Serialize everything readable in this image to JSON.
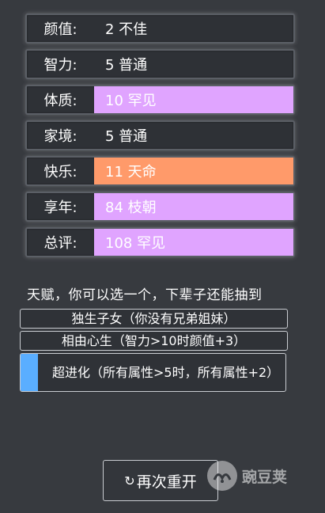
{
  "stats": [
    {
      "label": "颜值:",
      "value": "2 不佳",
      "color": "#2e3136"
    },
    {
      "label": "智力:",
      "value": "5 普通",
      "color": "#2e3136"
    },
    {
      "label": "体质:",
      "value": "10 罕见",
      "color": "#e0a4ff"
    },
    {
      "label": "家境:",
      "value": "5 普通",
      "color": "#2e3136"
    },
    {
      "label": "快乐:",
      "value": "11 天命",
      "color": "#ff9a6a"
    },
    {
      "label": "享年:",
      "value": "84 枝朝",
      "color": "#e0a4ff"
    },
    {
      "label": "总评:",
      "value": "108 罕见",
      "color": "#e0a4ff"
    }
  ],
  "talents": {
    "hint": "天赋，你可以选一个，下辈子还能抽到",
    "items": [
      {
        "text": "独生子女（你没有兄弟姐妹）",
        "selected": false
      },
      {
        "text": "相由心生（智力>10时颜值+3）",
        "selected": false
      },
      {
        "text": "超进化（所有属性>5时，所有属性+2）",
        "selected": true
      }
    ],
    "selected_color": "#5aaeff"
  },
  "restart": {
    "icon": "refresh-icon",
    "label": "再次重开"
  },
  "watermark": {
    "text": "豌豆荚"
  }
}
